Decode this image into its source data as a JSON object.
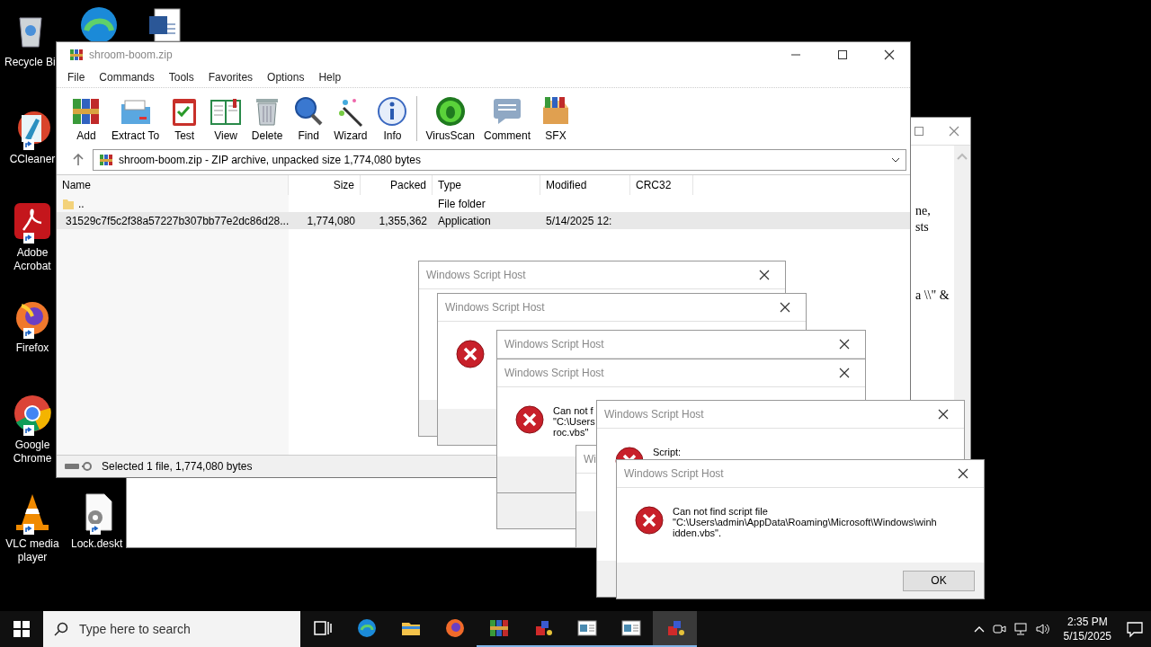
{
  "desktop_icons": [
    {
      "label": "Recycle Bi"
    },
    {
      "label": "CCleaner"
    },
    {
      "label": "Adobe Acrobat"
    },
    {
      "label": "Firefox"
    },
    {
      "label": "Google Chrome"
    },
    {
      "label": "VLC media player"
    },
    {
      "label": "Lock.deskt"
    }
  ],
  "document_window": {
    "lines": [
      "ne,",
      "sts",
      "a \\\\\" &"
    ]
  },
  "archive_window": {
    "title": "shroom-boom.zip",
    "menu": [
      "File",
      "Commands",
      "Tools",
      "Favorites",
      "Options",
      "Help"
    ],
    "toolbar": [
      "Add",
      "Extract To",
      "Test",
      "View",
      "Delete",
      "Find",
      "Wizard",
      "Info",
      "VirusScan",
      "Comment",
      "SFX"
    ],
    "address": "shroom-boom.zip - ZIP archive, unpacked size 1,774,080 bytes",
    "columns": [
      "Name",
      "Size",
      "Packed",
      "Type",
      "Modified",
      "CRC32"
    ],
    "rows": [
      {
        "kind": "folder",
        "name": "..",
        "type": "File folder",
        "selected": false
      },
      {
        "kind": "file",
        "name": "31529c7f5c2f38a57227b307bb77e2dc86d28...",
        "size": "1,774,080",
        "packed": "1,355,362",
        "type": "Application",
        "modified": "5/14/2025 12:",
        "selected": true
      }
    ],
    "status": "Selected 1 file, 1,774,080 bytes"
  },
  "dialogs": [
    {
      "kind": "plain",
      "title": "Windows Script Host"
    },
    {
      "kind": "error",
      "title": "Windows Script Host"
    },
    {
      "kind": "plain",
      "title": "Windows Script Host"
    },
    {
      "kind": "error",
      "title": "Windows Script Host",
      "message": "Can not f\n\"C:\\Users\nroc.vbs\""
    },
    {
      "kind": "plain",
      "title": "Wi"
    },
    {
      "kind": "error",
      "title": "Windows Script Host",
      "message": "Script:"
    },
    {
      "kind": "error",
      "title": "Windows Script Host",
      "message": "Can not find script file\n\"C:\\Users\\admin\\AppData\\Roaming\\Microsoft\\Windows\\winh\nidden.vbs\".",
      "button": "OK"
    }
  ],
  "taskbar": {
    "search": {
      "placeholder": "Type here to search"
    },
    "apps": [
      {
        "running": false,
        "selected": false
      },
      {
        "running": false,
        "selected": false
      },
      {
        "running": false,
        "selected": false
      },
      {
        "running": false,
        "selected": false
      },
      {
        "running": true,
        "selected": false
      },
      {
        "running": true,
        "selected": false
      },
      {
        "running": true,
        "selected": false
      },
      {
        "running": true,
        "selected": false
      },
      {
        "running": true,
        "selected": true
      }
    ],
    "time": "2:35 PM",
    "date": "5/15/2025"
  }
}
